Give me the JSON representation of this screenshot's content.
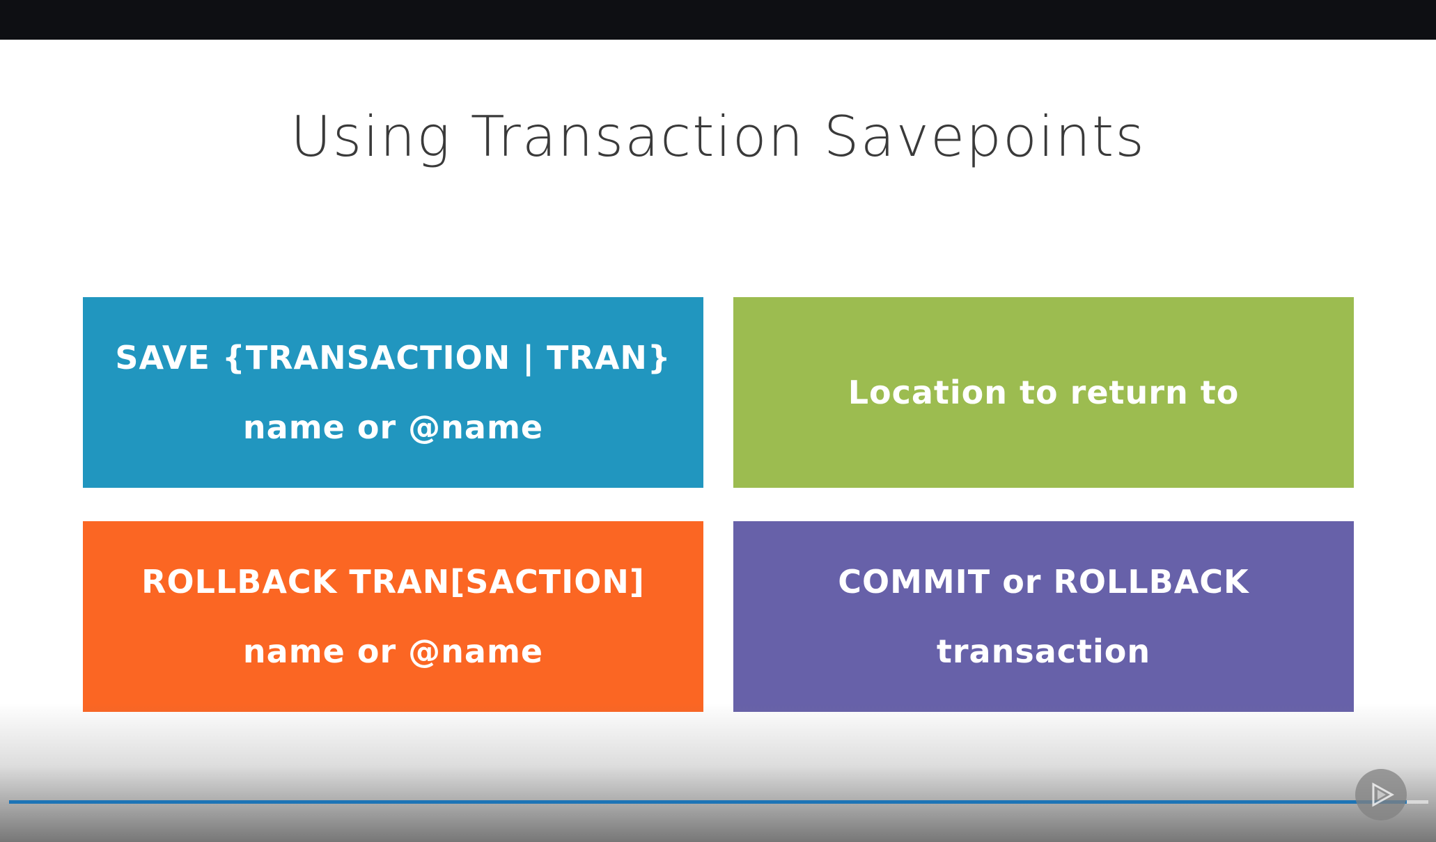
{
  "slide": {
    "title": "Using Transaction Savepoints"
  },
  "cards": {
    "save": {
      "line1": "SAVE {TRANSACTION | TRAN}",
      "line2": "name or @name",
      "color": "#2196bf"
    },
    "location": {
      "line1": "Location to return to",
      "color": "#9cbc50"
    },
    "rollback": {
      "line1": "ROLLBACK TRAN[SACTION]",
      "line2": "name or @name",
      "color": "#fb6623"
    },
    "commit": {
      "line1": "COMMIT or ROLLBACK",
      "line2": "transaction",
      "color": "#6761a9"
    }
  },
  "player": {
    "progress_fraction": 0.985,
    "progress_color": "#1d74b6",
    "logo_icon": "pluralsight-play-icon"
  }
}
